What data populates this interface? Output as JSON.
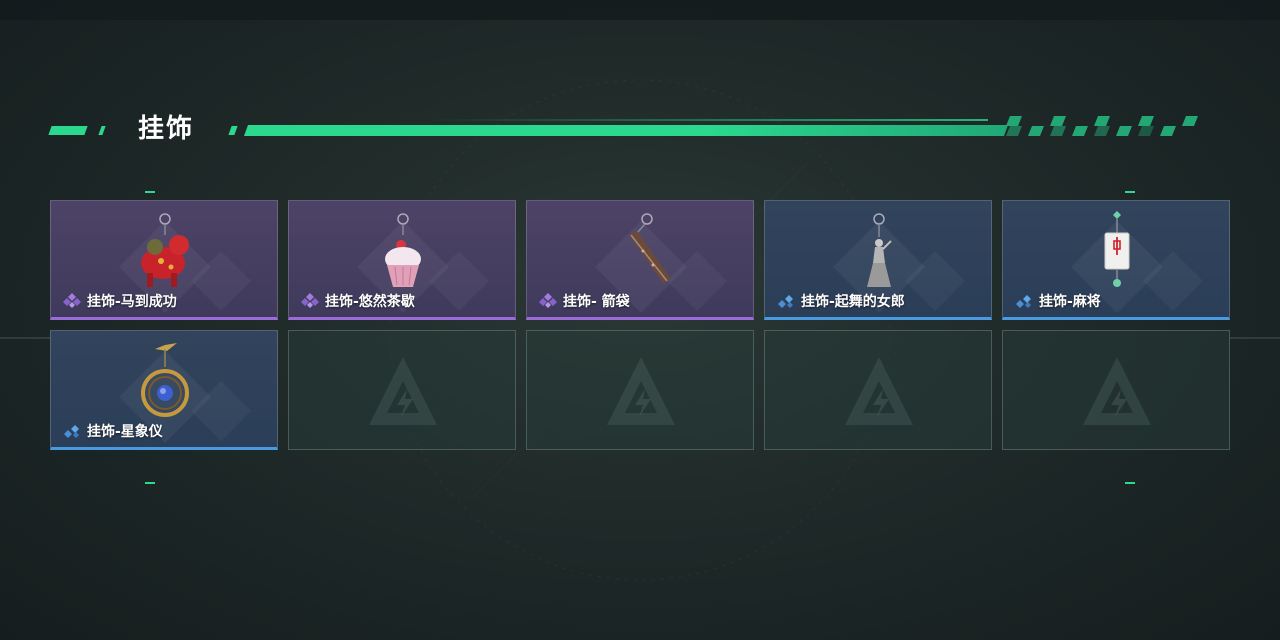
{
  "section": {
    "title": "挂饰"
  },
  "colors": {
    "accent": "#2bd98e",
    "rarity_purple": "#9b6bd8",
    "rarity_blue": "#4a9ae0"
  },
  "items": [
    {
      "label": "挂饰-马到成功",
      "rarity": "purple",
      "icon": "horse-charm-icon"
    },
    {
      "label": "挂饰-悠然茶歇",
      "rarity": "purple",
      "icon": "cupcake-charm-icon"
    },
    {
      "label": "挂饰- 箭袋",
      "rarity": "purple",
      "icon": "quiver-charm-icon"
    },
    {
      "label": "挂饰-起舞的女郎",
      "rarity": "blue",
      "icon": "dancer-charm-icon"
    },
    {
      "label": "挂饰-麻将",
      "rarity": "blue",
      "icon": "mahjong-charm-icon"
    },
    {
      "label": "挂饰-星象仪",
      "rarity": "blue",
      "icon": "astrolabe-charm-icon"
    }
  ],
  "empty_slots": 4
}
